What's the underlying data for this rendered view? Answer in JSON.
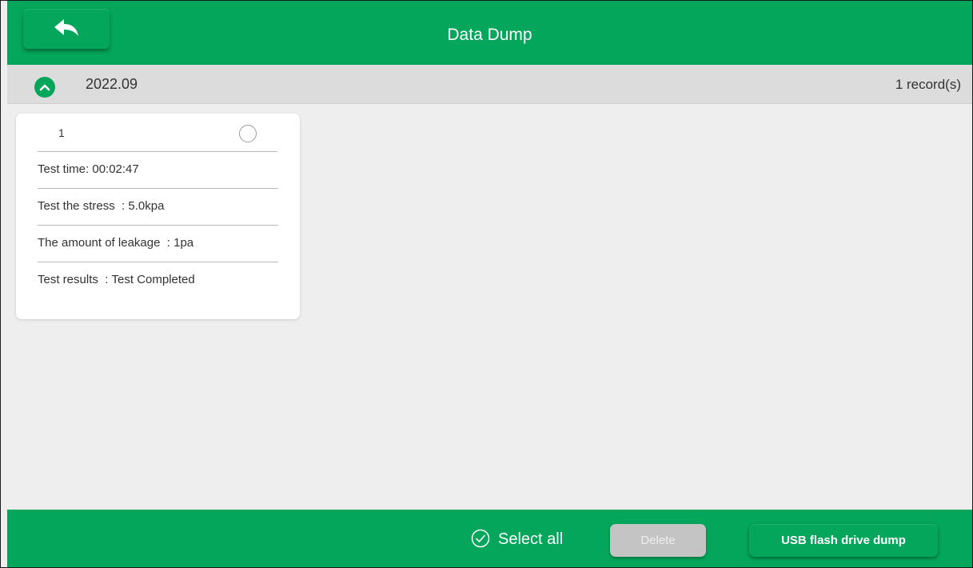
{
  "header": {
    "title": "Data Dump",
    "back_icon": "reply-arrow-icon"
  },
  "group": {
    "month": "2022.09",
    "record_count": "1 record(s)",
    "toggle_icon": "chevron-up-icon",
    "expanded": true
  },
  "records": [
    {
      "index": "1",
      "selected": false,
      "test_time": "Test time: 00:02:47",
      "test_stress": "Test the stress  : 5.0kpa",
      "leakage": "The amount of leakage  : 1pa",
      "result": "Test results  : Test Completed"
    }
  ],
  "footer": {
    "select_all_label": "Select all",
    "select_all_icon": "check-circle-icon",
    "delete_label": "Delete",
    "delete_enabled": false,
    "usb_dump_label": "USB flash drive dump"
  },
  "colors": {
    "brand_green": "#03a65a",
    "content_bg": "#eeeeee",
    "group_bar_bg": "#dcdcdc",
    "disabled_button": "#c4c4c4"
  }
}
